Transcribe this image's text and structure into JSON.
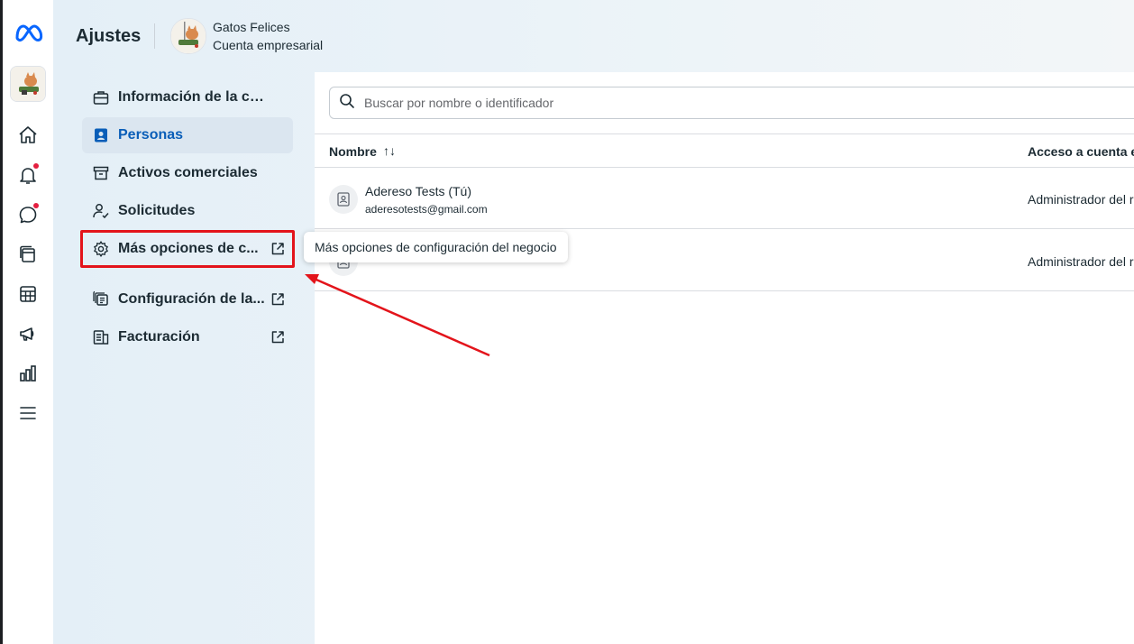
{
  "header": {
    "title": "Ajustes",
    "business_name": "Gatos Felices",
    "business_subtitle": "Cuenta empresarial"
  },
  "rail": {
    "logo": "meta-logo",
    "icons": [
      "home-icon",
      "bell-icon",
      "chat-icon",
      "pages-icon",
      "table-icon",
      "megaphone-icon",
      "chart-icon",
      "menu-icon"
    ]
  },
  "sidebar": {
    "items": [
      {
        "label": "Información de la cue...",
        "icon": "briefcase-icon",
        "active": false,
        "external": false
      },
      {
        "label": "Personas",
        "icon": "person-badge-icon",
        "active": true,
        "external": false
      },
      {
        "label": "Activos comerciales",
        "icon": "archive-box-icon",
        "active": false,
        "external": false
      },
      {
        "label": "Solicitudes",
        "icon": "person-check-icon",
        "active": false,
        "external": false
      },
      {
        "label": "Más opciones de c...",
        "icon": "gear-icon",
        "active": false,
        "external": true
      },
      {
        "label": "Configuración de la...",
        "icon": "layers-icon",
        "active": false,
        "external": true
      },
      {
        "label": "Facturación",
        "icon": "billing-icon",
        "active": false,
        "external": true
      }
    ]
  },
  "tooltip": {
    "text": "Más opciones de configuración del negocio"
  },
  "main": {
    "search_placeholder": "Buscar por nombre o identificador",
    "columns": {
      "name": "Nombre",
      "sort_glyph": "↑↓",
      "access": "Acceso a cuenta e"
    },
    "rows": [
      {
        "name": "Adereso Tests (Tú)",
        "email": "aderesotests@gmail.com",
        "access": "Administrador del r"
      },
      {
        "name": "",
        "email": "",
        "access": "Administrador del r"
      }
    ]
  },
  "colors": {
    "accent": "#0a5eb8",
    "highlight_box": "#e3141b",
    "notification_dot": "#e41e3f"
  }
}
